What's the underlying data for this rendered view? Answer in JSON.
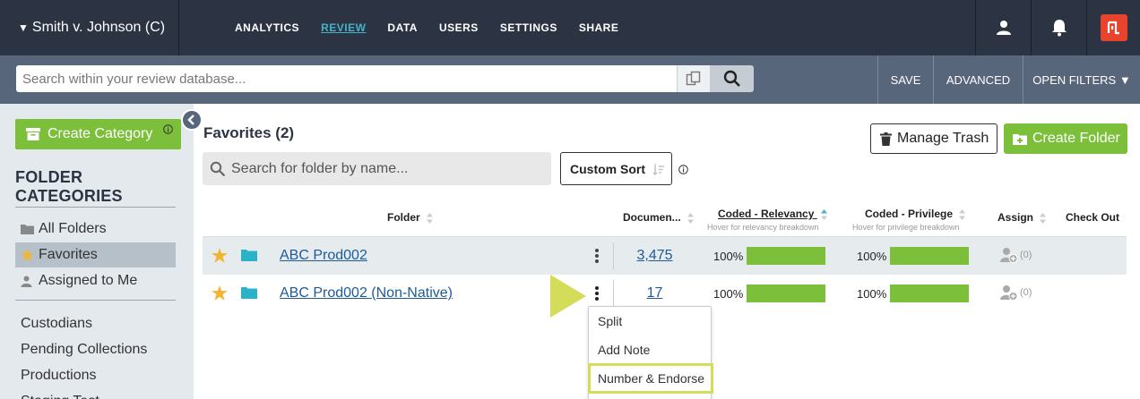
{
  "header": {
    "case_name": "Smith v. Johnson (C)",
    "nav": [
      {
        "label": "ANALYTICS"
      },
      {
        "label": "REVIEW"
      },
      {
        "label": "DATA"
      },
      {
        "label": "USERS"
      },
      {
        "label": "SETTINGS"
      },
      {
        "label": "SHARE"
      }
    ],
    "active_nav": "REVIEW",
    "icons": [
      "user-icon",
      "bell-icon",
      "brand-logo-icon"
    ],
    "brand_color": "#e8432d"
  },
  "search_bar": {
    "placeholder": "Search within your review database...",
    "save_label": "SAVE",
    "advanced_label": "ADVANCED",
    "open_filters_label": "OPEN FILTERS ▼"
  },
  "sidebar": {
    "create_category_label": "Create Category",
    "title": "FOLDER CATEGORIES",
    "top_items": [
      {
        "label": "All Folders",
        "icon": "folder-icon"
      },
      {
        "label": "Favorites",
        "icon": "star-icon",
        "selected": true
      },
      {
        "label": "Assigned to Me",
        "icon": "person-icon"
      }
    ],
    "categories": [
      {
        "label": "Custodians"
      },
      {
        "label": "Pending Collections"
      },
      {
        "label": "Productions"
      },
      {
        "label": "Staging Test"
      }
    ]
  },
  "main": {
    "title": "Favorites (2)",
    "manage_trash_label": "Manage Trash",
    "create_folder_label": "Create Folder",
    "folder_search_placeholder": "Search for folder by name...",
    "custom_sort_label": "Custom Sort",
    "columns": {
      "folder": "Folder",
      "documents": "Documen...",
      "coded_relevancy": "Coded - Relevancy",
      "coded_relevancy_hint": "Hover for relevancy breakdown",
      "coded_privilege": "Coded - Privilege",
      "coded_privilege_hint": "Hover for privilege breakdown",
      "assign": "Assign",
      "check_out": "Check Out"
    },
    "rows": [
      {
        "name": "ABC Prod002",
        "documents": "3,475",
        "relevancy_pct": "100%",
        "relevancy_fill": 1.0,
        "privilege_pct": "100%",
        "privilege_fill": 1.0,
        "assign_count": "(0)"
      },
      {
        "name": "ABC Prod002 (Non-Native)",
        "documents": "17",
        "relevancy_pct": "100%",
        "relevancy_fill": 1.0,
        "privilege_pct": "100%",
        "privilege_fill": 1.0,
        "assign_count": "(0)"
      }
    ],
    "row_menu": [
      {
        "label": "Split"
      },
      {
        "label": "Add Note"
      },
      {
        "label": "Number & Endorse",
        "highlighted": true
      }
    ],
    "accent_green": "#7cbf3a",
    "highlight_color": "#d4dd5a"
  }
}
